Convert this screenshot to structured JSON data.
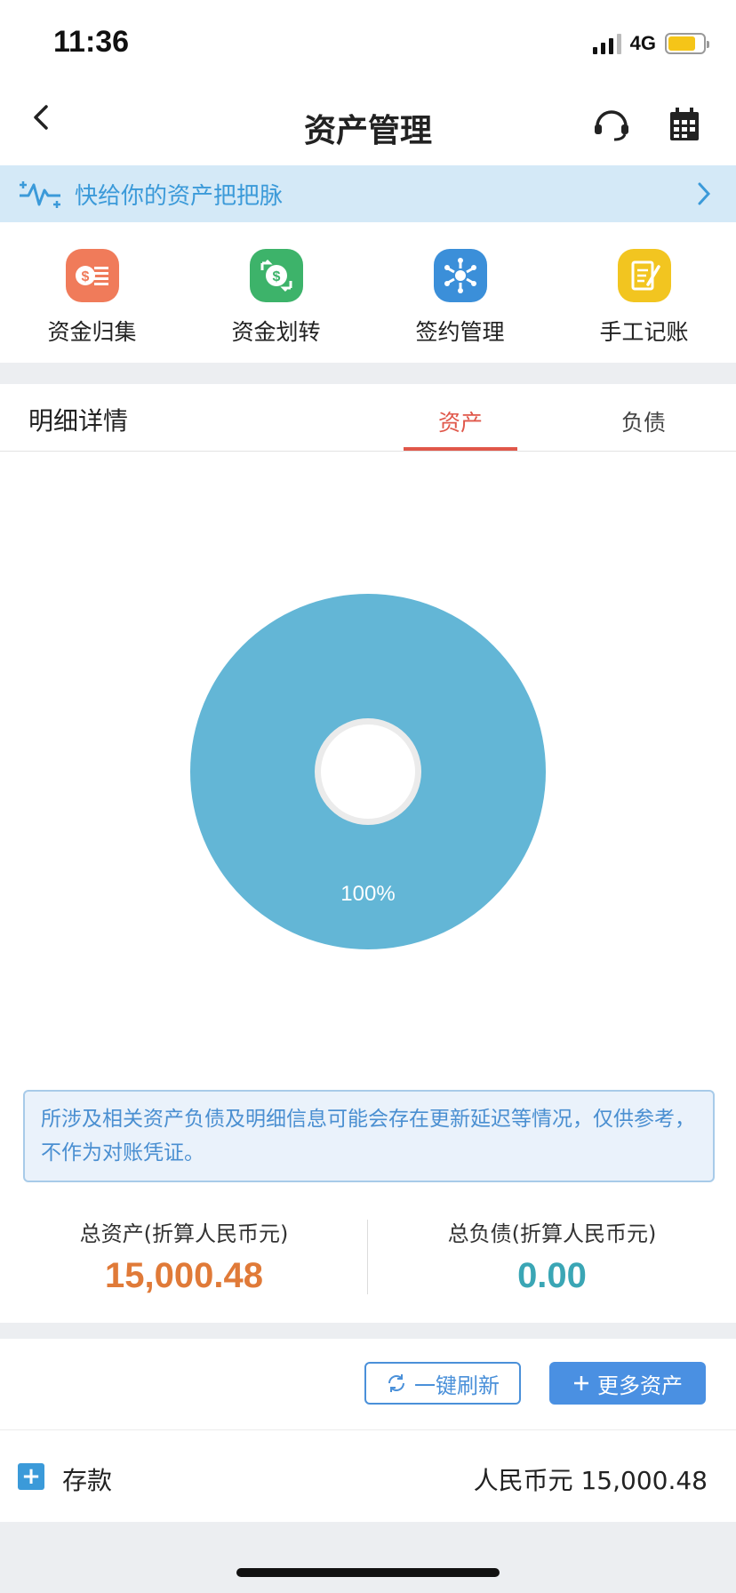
{
  "status_bar": {
    "time": "11:36",
    "network": "4G"
  },
  "header": {
    "title": "资产管理"
  },
  "banner": {
    "text": "快给你的资产把把脉"
  },
  "shortcuts": [
    {
      "label": "资金归集",
      "icon": "cash-collect-icon",
      "color": "#f07b5a"
    },
    {
      "label": "资金划转",
      "icon": "money-transfer-icon",
      "color": "#3db36a"
    },
    {
      "label": "签约管理",
      "icon": "contract-gear-icon",
      "color": "#3b8fd9"
    },
    {
      "label": "手工记账",
      "icon": "manual-ledger-icon",
      "color": "#f2c520"
    }
  ],
  "details": {
    "title": "明细详情",
    "tabs": [
      {
        "label": "资产",
        "active": true
      },
      {
        "label": "负债",
        "active": false
      }
    ]
  },
  "chart_data": {
    "type": "pie",
    "slices": [
      {
        "value": 100,
        "label": "100%",
        "color": "#63b6d6"
      }
    ]
  },
  "notice": "所涉及相关资产负债及明细信息可能会存在更新延迟等情况，仅供参考，不作为对账凭证。",
  "totals": {
    "assets_label": "总资产(折算人民币元)",
    "assets_value": "15,000.48",
    "assets_color": "#e07a38",
    "liabilities_label": "总负债(折算人民币元)",
    "liabilities_value": "0.00",
    "liabilities_color": "#3aa6b5"
  },
  "actions": {
    "refresh": "一键刷新",
    "more_assets": "更多资产"
  },
  "deposit": {
    "label": "存款",
    "amount": "人民币元 15,000.48"
  }
}
